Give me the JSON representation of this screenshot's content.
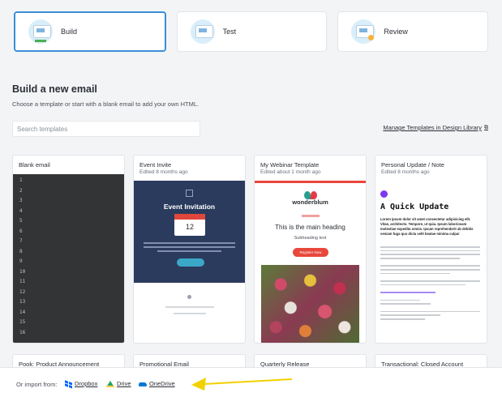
{
  "steps": [
    {
      "label": "Build",
      "active": true
    },
    {
      "label": "Test",
      "active": false
    },
    {
      "label": "Review",
      "active": false
    }
  ],
  "section": {
    "title": "Build a new email",
    "subtitle": "Choose a template or start with a blank email to add your own HTML."
  },
  "search": {
    "placeholder": "Search templates"
  },
  "manage_link": "Manage Templates in Design Library",
  "templates": [
    {
      "title": "Blank email",
      "meta": ""
    },
    {
      "title": "Event Invite",
      "meta": "Edited 8 months ago"
    },
    {
      "title": "My Webinar Template",
      "meta": "Edited about 1 month ago"
    },
    {
      "title": "Personal Update / Note",
      "meta": "Edited 8 months ago"
    }
  ],
  "line_numbers": [
    "1",
    "2",
    "3",
    "4",
    "5",
    "6",
    "7",
    "8",
    "9",
    "10",
    "11",
    "12",
    "13",
    "14",
    "15",
    "16"
  ],
  "event_preview": {
    "heading": "Event Invitation",
    "day": "12"
  },
  "webinar_preview": {
    "brand": "wonderblum",
    "heading": "This is the main heading",
    "subheading": "Subheading text",
    "button": "Register Now"
  },
  "personal_preview": {
    "heading": "A Quick Update",
    "lead": "Lorem ipsum dolor sit amet consectetur adipisicing elit. Vitae, architecto. Tempore, ut quia. Ipsum laboriosam molestiae expedita omnis. Ipsum reprehenderit ab debitis veniam fuga quo dicta velit beatae minima culpa!"
  },
  "more_templates": [
    {
      "title": "Pook: Product Announcement"
    },
    {
      "title": "Promotional Email"
    },
    {
      "title": "Quarterly Release"
    },
    {
      "title": "Transactional: Closed Account"
    }
  ],
  "import": {
    "label": "Or import from:",
    "sources": [
      "Dropbox",
      "Drive",
      "OneDrive"
    ]
  },
  "colors": {
    "accent": "#3b8fd8",
    "arrow": "#f2d100"
  }
}
